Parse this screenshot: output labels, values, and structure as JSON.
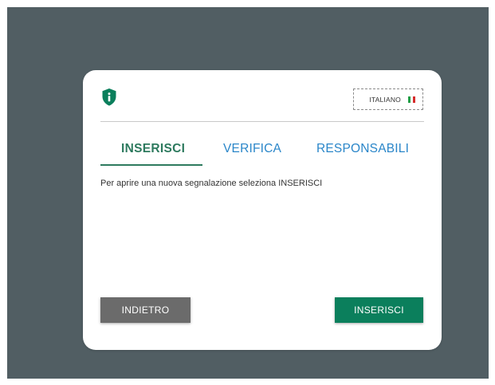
{
  "header": {
    "logo_icon": "shield-info-icon",
    "language": {
      "label": "ITALIANO",
      "flag_icon": "italian-flag-icon",
      "flag_colors": [
        "#1f9e46",
        "#ffffff",
        "#d62b2b"
      ]
    }
  },
  "tabs": [
    {
      "label": "INSERISCI",
      "active": true
    },
    {
      "label": "VERIFICA",
      "active": false
    },
    {
      "label": "RESPONSABILI",
      "active": false
    }
  ],
  "content": {
    "description": "Per aprire una nuova segnalazione seleziona INSERISCI"
  },
  "actions": {
    "back_label": "INDIETRO",
    "insert_label": "INSERISCI"
  },
  "colors": {
    "backdrop": "#515e63",
    "brand_green": "#0b7f5c",
    "tab_active": "#2d7a5e",
    "tab_inactive": "#2a86c9",
    "button_back": "#6b6b6b"
  }
}
